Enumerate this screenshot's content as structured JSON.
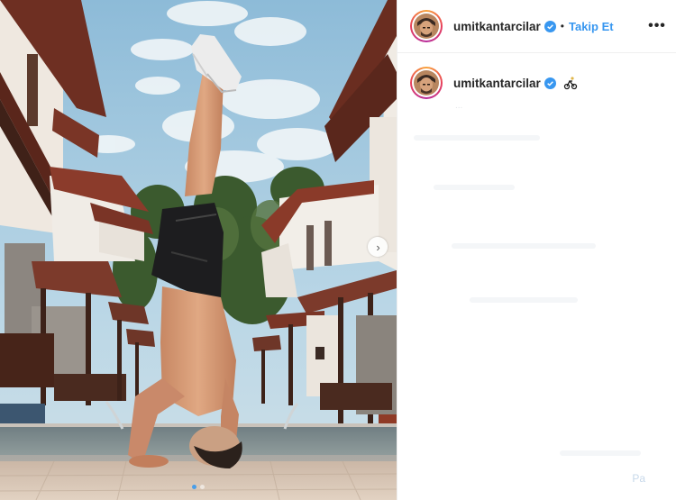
{
  "post": {
    "username": "umitkantarcilar",
    "follow_label": "Takip Et",
    "separator": "•",
    "more_icon": "more-options-icon",
    "caption_emoji": "bicycle-emoji",
    "verified_icon": "verified-badge-icon",
    "carousel": {
      "total_slides": 2,
      "active_slide": 1
    }
  },
  "colors": {
    "follow_blue": "#3897f0",
    "verified_blue": "#3897f0",
    "sky": "#9fc6de",
    "roof": "#8a3b2a"
  },
  "ghost": {
    "comment_hint": "...",
    "corner_text": "Pa"
  }
}
